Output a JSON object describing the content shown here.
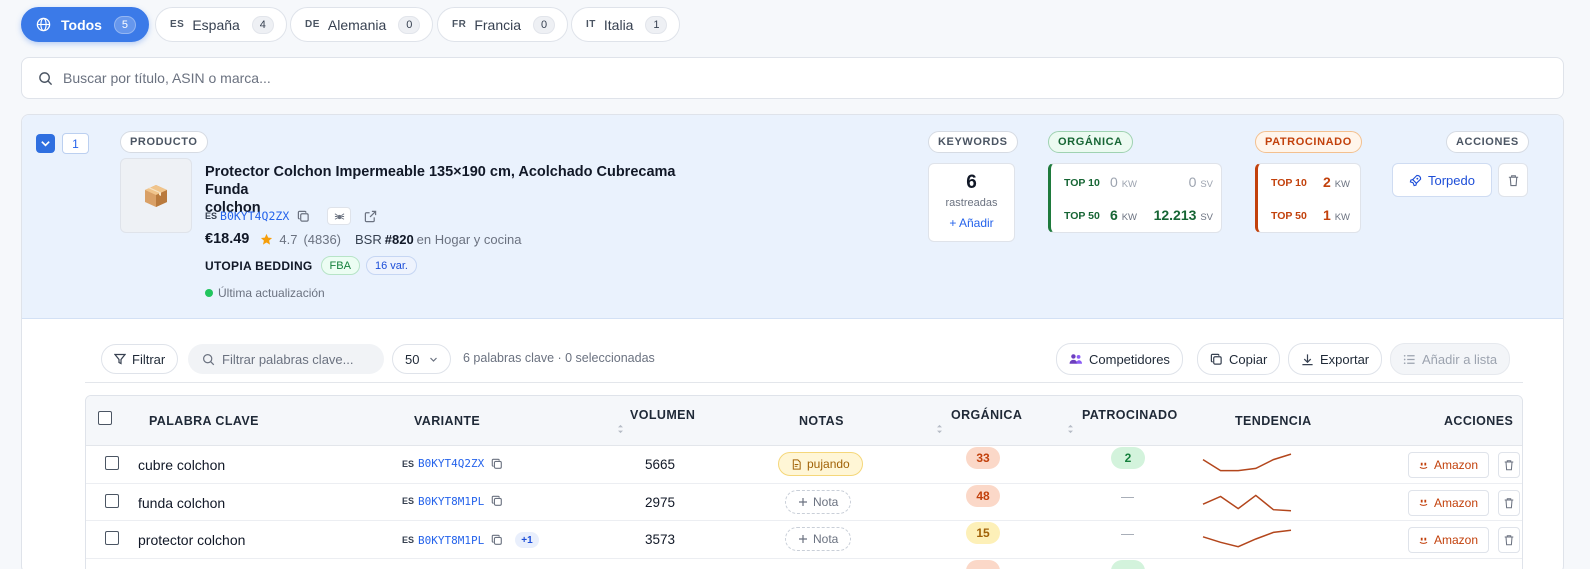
{
  "markets": [
    {
      "code": "",
      "label": "Todos",
      "count": "5",
      "active": true
    },
    {
      "code": "ES",
      "label": "España",
      "count": "4"
    },
    {
      "code": "DE",
      "label": "Alemania",
      "count": "0"
    },
    {
      "code": "FR",
      "label": "Francia",
      "count": "0"
    },
    {
      "code": "IT",
      "label": "Italia",
      "count": "1"
    }
  ],
  "search": {
    "placeholder": "Buscar por título, ASIN o marca..."
  },
  "product": {
    "index": "1",
    "section_label": "PRODUCTO",
    "title_line1": "Protector Colchon Impermeable 135×190 cm, Acolchado Cubrecama Funda",
    "title_line2": "colchon",
    "market": "ES",
    "asin": "B0KYT4Q2ZX",
    "price": "€18.49",
    "rating": "4.7",
    "reviews": "(4836)",
    "bsr_label": "BSR",
    "bsr_rank": "#820",
    "bsr_category": "en Hogar y cocina",
    "brand": "UTOPIA BEDDING",
    "fba_badge": "FBA",
    "variants_badge": "16 var.",
    "update_status": "Última actualización"
  },
  "keywords_panel": {
    "label": "KEYWORDS",
    "count": "6",
    "sub": "rastreadas",
    "add": "+ Añadir"
  },
  "organic_panel": {
    "label": "ORGÁNICA",
    "top10_label": "TOP 10",
    "top10_kw": "0",
    "top10_sv": "0",
    "top50_label": "TOP 50",
    "top50_kw": "6",
    "top50_sv": "12.213",
    "kw_unit": "KW",
    "sv_unit": "SV"
  },
  "sponsored_panel": {
    "label": "PATROCINADO",
    "top10_label": "TOP 10",
    "top10_kw": "2",
    "top50_label": "TOP 50",
    "top50_kw": "1",
    "kw_unit": "KW"
  },
  "actions_panel": {
    "label": "ACCIONES",
    "torpedo": "Torpedo"
  },
  "toolbar": {
    "filter": "Filtrar",
    "keyword_search_placeholder": "Filtrar palabras clave...",
    "page_size": "50",
    "summary": "6 palabras clave · 0 seleccionadas",
    "competitors": "Competidores",
    "copy": "Copiar",
    "export": "Exportar",
    "add_to_list": "Añadir a lista"
  },
  "table": {
    "headers": {
      "keyword": "PALABRA CLAVE",
      "variant": "VARIANTE",
      "volume": "VOLUMEN",
      "notes": "NOTAS",
      "organic": "ORGÁNICA",
      "sponsored": "PATROCINADO",
      "trend": "TENDENCIA",
      "actions": "ACCIONES"
    },
    "rows": [
      {
        "keyword": "cubre colchon",
        "market": "ES",
        "asin": "B0KYT4Q2ZX",
        "extra": "",
        "volume": "5665",
        "note": "pujando",
        "organic": "33",
        "sponsored": "2",
        "trend": [
          14,
          4,
          4,
          6,
          14,
          19
        ],
        "amazon": "Amazon"
      },
      {
        "keyword": "funda colchon",
        "market": "ES",
        "asin": "B0KYT8M1PL",
        "extra": "",
        "volume": "2975",
        "note": "Nota",
        "organic": "48",
        "sponsored": "—",
        "trend": [
          8,
          15,
          4,
          16,
          3,
          2
        ],
        "amazon": "Amazon"
      },
      {
        "keyword": "protector colchon",
        "market": "ES",
        "asin": "B0KYT8M1PL",
        "extra": "+1",
        "volume": "3573",
        "note": "Nota",
        "organic": "15",
        "sponsored": "—",
        "trend": [
          12,
          7,
          3,
          10,
          16,
          18
        ],
        "amazon": "Amazon"
      }
    ]
  },
  "colors": {
    "accent": "#3b7ae8",
    "organic": "#1e7a3c",
    "sponsored": "#c2410c",
    "card_bg": "#eaf2fd"
  }
}
